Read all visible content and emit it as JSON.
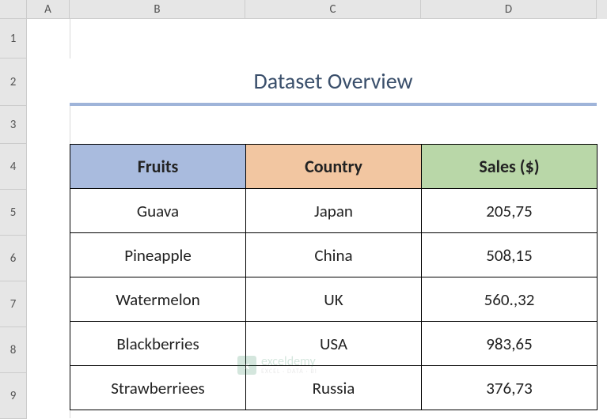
{
  "columns": {
    "A": "A",
    "B": "B",
    "C": "C",
    "D": "D"
  },
  "rows": {
    "r1": "1",
    "r2": "2",
    "r3": "3",
    "r4": "4",
    "r5": "5",
    "r6": "6",
    "r7": "7",
    "r8": "8",
    "r9": "9"
  },
  "title": "Dataset Overview",
  "headers": {
    "fruits": "Fruits",
    "country": "Country",
    "sales": "Sales ($)"
  },
  "data": [
    {
      "fruit": "Guava",
      "country": "Japan",
      "sales": "205,75"
    },
    {
      "fruit": "Pineapple",
      "country": "China",
      "sales": "508,15"
    },
    {
      "fruit": "Watermelon",
      "country": "UK",
      "sales": "560.,32"
    },
    {
      "fruit": "Blackberries",
      "country": "USA",
      "sales": "983,65"
    },
    {
      "fruit": "Strawberriees",
      "country": "Russia",
      "sales": "376,73"
    }
  ],
  "watermark": {
    "brand": "exceldemy",
    "tag": "EXCEL · DATA · BI"
  }
}
